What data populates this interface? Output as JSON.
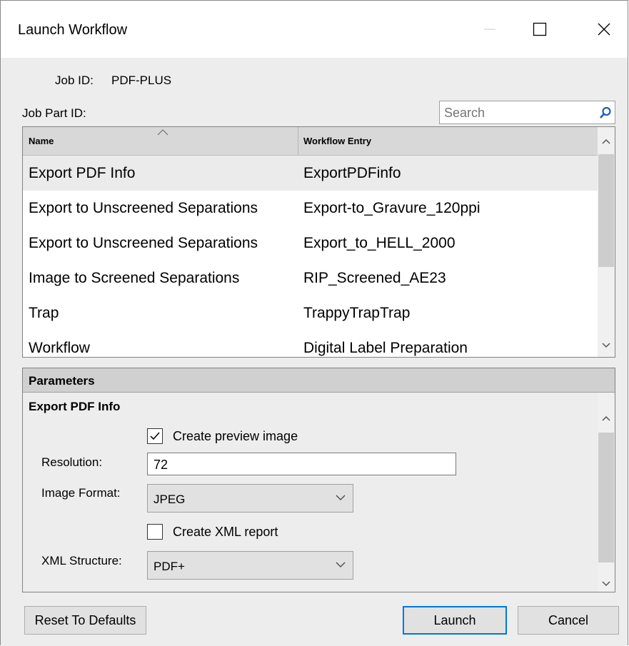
{
  "window": {
    "title": "Launch Workflow",
    "controls": [
      "minimize-icon",
      "maximize-icon",
      "close-icon"
    ]
  },
  "job": {
    "job_id_label": "Job ID:",
    "job_id_value": "PDF-PLUS",
    "job_part_label": "Job Part ID:"
  },
  "search": {
    "placeholder": "Search",
    "icon": "search-icon"
  },
  "grid": {
    "columns": [
      "Name",
      "Workflow Entry"
    ],
    "rows": [
      {
        "name": "Export PDF Info",
        "entry": "ExportPDFinfo",
        "selected": true
      },
      {
        "name": "Export to Unscreened Separations",
        "entry": "Export-to_Gravure_120ppi"
      },
      {
        "name": "Export to Unscreened Separations",
        "entry": "Export_to_HELL_2000"
      },
      {
        "name": "Image to Screened Separations",
        "entry": "RIP_Screened_AE23"
      },
      {
        "name": "Trap",
        "entry": "TrappyTrapTrap"
      },
      {
        "name": "Workflow",
        "entry": "Digital Label Preparation"
      }
    ]
  },
  "parameters": {
    "header": "Parameters",
    "section_title": "Export PDF Info",
    "create_preview": {
      "label": "Create preview image",
      "checked": true
    },
    "resolution": {
      "label": "Resolution:",
      "value": "72"
    },
    "image_format": {
      "label": "Image Format:",
      "value": "JPEG"
    },
    "create_xml": {
      "label": "Create XML report",
      "checked": false
    },
    "xml_structure": {
      "label": "XML Structure:",
      "value": "PDF+"
    }
  },
  "buttons": {
    "reset": "Reset To Defaults",
    "launch": "Launch",
    "cancel": "Cancel"
  },
  "colors": {
    "accent": "#0078d7",
    "selection": "#ebebeb",
    "header": "#d8d8d8"
  }
}
